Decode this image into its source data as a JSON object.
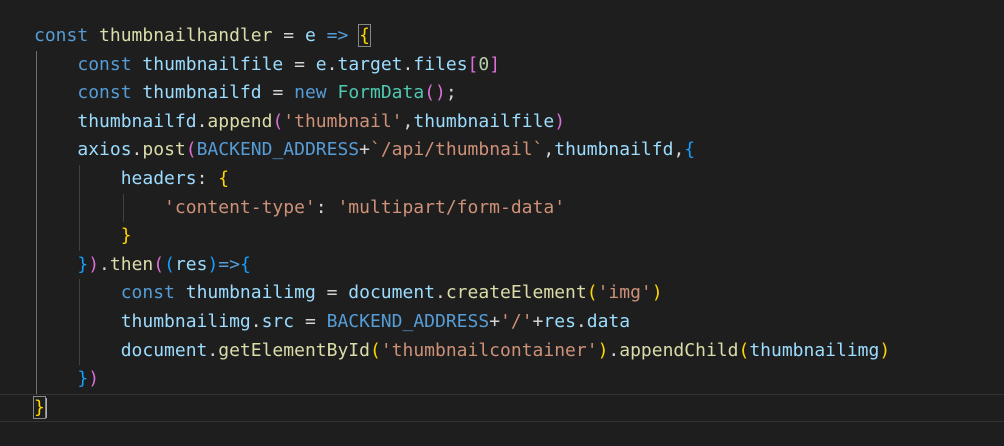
{
  "colors": {
    "background": "#1e1e1e",
    "keyword": "#569cd6",
    "variable": "#9cdcfe",
    "function": "#dcdcaa",
    "class": "#4ec9b0",
    "string": "#ce9178",
    "number": "#b5cea8",
    "punctuation": "#d4d4d4",
    "bracket_level_1": "#ffd700",
    "bracket_level_2": "#da70d6",
    "bracket_level_3": "#179fff"
  },
  "code_lines": [
    {
      "indent": "",
      "tokens": [
        {
          "t": "const",
          "c": "kw"
        },
        {
          "t": " ",
          "c": "pl"
        },
        {
          "t": "thumbnailhandler",
          "c": "fn"
        },
        {
          "t": " = ",
          "c": "pl"
        },
        {
          "t": "e",
          "c": "var"
        },
        {
          "t": " ",
          "c": "pl"
        },
        {
          "t": "=>",
          "c": "kw"
        },
        {
          "t": " ",
          "c": "pl"
        },
        {
          "t": "{",
          "c": "br1",
          "match": true
        }
      ]
    },
    {
      "indent": "    ",
      "tokens": [
        {
          "t": "const",
          "c": "kw"
        },
        {
          "t": " ",
          "c": "pl"
        },
        {
          "t": "thumbnailfile",
          "c": "var"
        },
        {
          "t": " = ",
          "c": "pl"
        },
        {
          "t": "e",
          "c": "var"
        },
        {
          "t": ".",
          "c": "pl"
        },
        {
          "t": "target",
          "c": "var"
        },
        {
          "t": ".",
          "c": "pl"
        },
        {
          "t": "files",
          "c": "var"
        },
        {
          "t": "[",
          "c": "br2"
        },
        {
          "t": "0",
          "c": "num"
        },
        {
          "t": "]",
          "c": "br2"
        }
      ]
    },
    {
      "indent": "    ",
      "tokens": [
        {
          "t": "const",
          "c": "kw"
        },
        {
          "t": " ",
          "c": "pl"
        },
        {
          "t": "thumbnailfd",
          "c": "var"
        },
        {
          "t": " = ",
          "c": "pl"
        },
        {
          "t": "new",
          "c": "kw"
        },
        {
          "t": " ",
          "c": "pl"
        },
        {
          "t": "FormData",
          "c": "cls"
        },
        {
          "t": "()",
          "c": "br2"
        },
        {
          "t": ";",
          "c": "pl"
        }
      ]
    },
    {
      "indent": "    ",
      "tokens": [
        {
          "t": "thumbnailfd",
          "c": "var"
        },
        {
          "t": ".",
          "c": "pl"
        },
        {
          "t": "append",
          "c": "fn"
        },
        {
          "t": "(",
          "c": "br2"
        },
        {
          "t": "'thumbnail'",
          "c": "str"
        },
        {
          "t": ",",
          "c": "pl"
        },
        {
          "t": "thumbnailfile",
          "c": "var"
        },
        {
          "t": ")",
          "c": "br2"
        }
      ]
    },
    {
      "indent": "    ",
      "tokens": [
        {
          "t": "axios",
          "c": "var"
        },
        {
          "t": ".",
          "c": "pl"
        },
        {
          "t": "post",
          "c": "fn"
        },
        {
          "t": "(",
          "c": "br2"
        },
        {
          "t": "BACKEND_ADDRESS",
          "c": "kw"
        },
        {
          "t": "+",
          "c": "pl"
        },
        {
          "t": "`/api/thumbnail`",
          "c": "str"
        },
        {
          "t": ",",
          "c": "pl"
        },
        {
          "t": "thumbnailfd",
          "c": "var"
        },
        {
          "t": ",",
          "c": "pl"
        },
        {
          "t": "{",
          "c": "br3"
        }
      ]
    },
    {
      "indent": "        ",
      "tokens": [
        {
          "t": "headers",
          "c": "var"
        },
        {
          "t": ": ",
          "c": "pl"
        },
        {
          "t": "{",
          "c": "br1"
        }
      ]
    },
    {
      "indent": "            ",
      "tokens": [
        {
          "t": "'content-type'",
          "c": "str"
        },
        {
          "t": ": ",
          "c": "pl"
        },
        {
          "t": "'multipart/form-data'",
          "c": "str"
        }
      ]
    },
    {
      "indent": "        ",
      "tokens": [
        {
          "t": "}",
          "c": "br1"
        }
      ]
    },
    {
      "indent": "    ",
      "tokens": [
        {
          "t": "}",
          "c": "br3"
        },
        {
          "t": ")",
          "c": "br2"
        },
        {
          "t": ".",
          "c": "pl"
        },
        {
          "t": "then",
          "c": "fn"
        },
        {
          "t": "(",
          "c": "br2"
        },
        {
          "t": "(",
          "c": "br3"
        },
        {
          "t": "res",
          "c": "var"
        },
        {
          "t": ")",
          "c": "br3"
        },
        {
          "t": "=>",
          "c": "kw"
        },
        {
          "t": "{",
          "c": "br3"
        }
      ]
    },
    {
      "indent": "        ",
      "tokens": [
        {
          "t": "const",
          "c": "kw"
        },
        {
          "t": " ",
          "c": "pl"
        },
        {
          "t": "thumbnailimg",
          "c": "var"
        },
        {
          "t": " = ",
          "c": "pl"
        },
        {
          "t": "document",
          "c": "var"
        },
        {
          "t": ".",
          "c": "pl"
        },
        {
          "t": "createElement",
          "c": "fn"
        },
        {
          "t": "(",
          "c": "br1"
        },
        {
          "t": "'img'",
          "c": "str"
        },
        {
          "t": ")",
          "c": "br1"
        }
      ]
    },
    {
      "indent": "        ",
      "tokens": [
        {
          "t": "thumbnailimg",
          "c": "var"
        },
        {
          "t": ".",
          "c": "pl"
        },
        {
          "t": "src",
          "c": "var"
        },
        {
          "t": " = ",
          "c": "pl"
        },
        {
          "t": "BACKEND_ADDRESS",
          "c": "kw"
        },
        {
          "t": "+",
          "c": "pl"
        },
        {
          "t": "'/'",
          "c": "str"
        },
        {
          "t": "+",
          "c": "pl"
        },
        {
          "t": "res",
          "c": "var"
        },
        {
          "t": ".",
          "c": "pl"
        },
        {
          "t": "data",
          "c": "var"
        }
      ]
    },
    {
      "indent": "        ",
      "tokens": [
        {
          "t": "document",
          "c": "var"
        },
        {
          "t": ".",
          "c": "pl"
        },
        {
          "t": "getElementById",
          "c": "fn"
        },
        {
          "t": "(",
          "c": "br1"
        },
        {
          "t": "'thumbnailcontainer'",
          "c": "str"
        },
        {
          "t": ")",
          "c": "br1"
        },
        {
          "t": ".",
          "c": "pl"
        },
        {
          "t": "appendChild",
          "c": "fn"
        },
        {
          "t": "(",
          "c": "br1"
        },
        {
          "t": "thumbnailimg",
          "c": "var"
        },
        {
          "t": ")",
          "c": "br1"
        }
      ]
    },
    {
      "indent": "    ",
      "tokens": [
        {
          "t": "}",
          "c": "br3"
        },
        {
          "t": ")",
          "c": "br2"
        }
      ]
    },
    {
      "indent": "",
      "current": true,
      "tokens": [
        {
          "t": "}",
          "c": "br1",
          "match": true
        }
      ]
    }
  ]
}
